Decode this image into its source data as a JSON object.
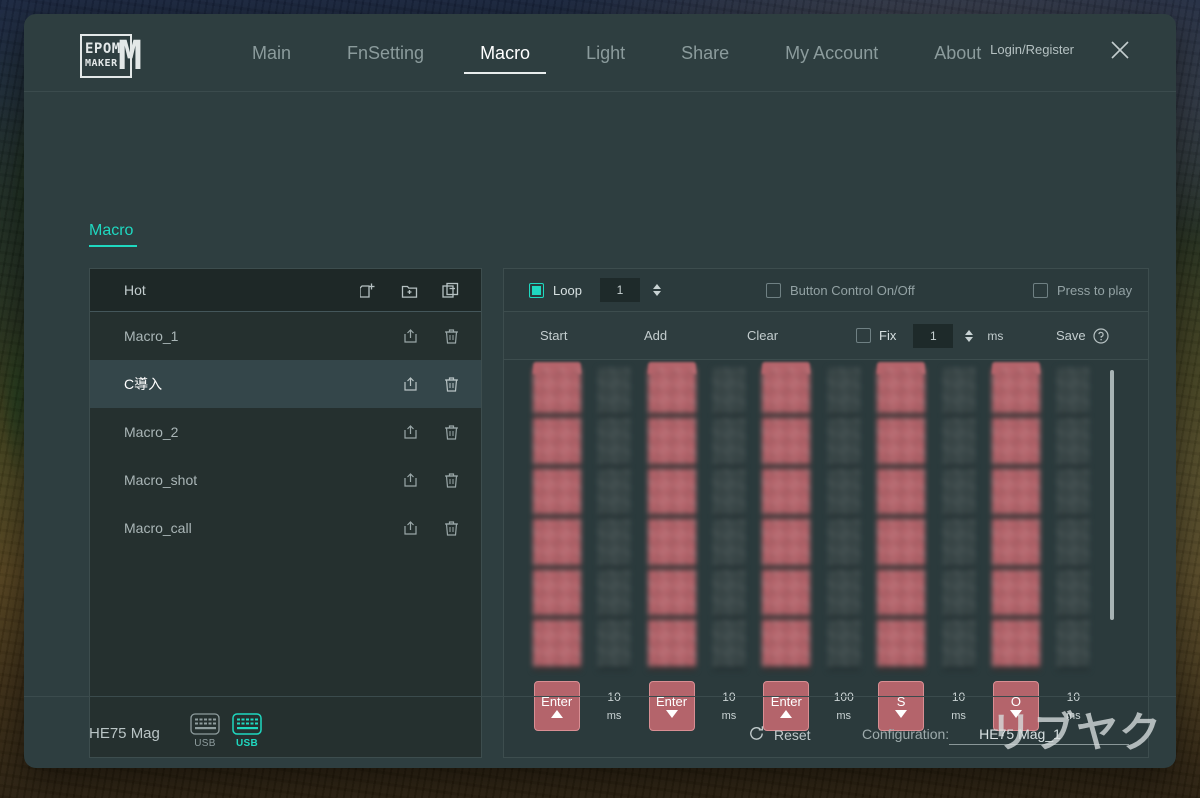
{
  "window": {
    "logo_line1": "EPOM",
    "logo_line2": "MAKER",
    "logo_mark": "M",
    "login_label": "Login/Register",
    "close_icon": "close-icon"
  },
  "nav": {
    "tabs": [
      {
        "label": "Main",
        "active": false
      },
      {
        "label": "FnSetting",
        "active": false
      },
      {
        "label": "Macro",
        "active": true
      },
      {
        "label": "Light",
        "active": false
      },
      {
        "label": "Share",
        "active": false
      },
      {
        "label": "My Account",
        "active": false
      },
      {
        "label": "About",
        "active": false
      }
    ]
  },
  "section": {
    "title": "Macro",
    "accent_color": "#1fd8c0"
  },
  "macro_list": {
    "header_label": "Hot",
    "header_icons": [
      "new-file-icon",
      "new-folder-icon",
      "duplicate-icon"
    ],
    "items": [
      {
        "label": "Macro_1",
        "selected": false
      },
      {
        "label": "C導入",
        "selected": true
      },
      {
        "label": "Macro_2",
        "selected": false
      },
      {
        "label": "Macro_shot",
        "selected": false
      },
      {
        "label": "Macro_call",
        "selected": false
      }
    ],
    "row_icons": [
      "export-icon",
      "delete-icon"
    ]
  },
  "options_bar": {
    "loop_label": "Loop",
    "loop_checked": true,
    "loop_count": "1",
    "button_control_label": "Button Control On/Off",
    "button_control_checked": false,
    "press_to_play_label": "Press to play",
    "press_to_play_checked": false
  },
  "action_bar": {
    "start_label": "Start",
    "add_label": "Add",
    "clear_label": "Clear",
    "fix_label": "Fix",
    "fix_checked": false,
    "fix_value": "1",
    "fix_unit": "ms",
    "save_label": "Save",
    "help_icon": "help-icon"
  },
  "timeline": {
    "events": [
      {
        "type": "key",
        "name": "Enter",
        "direction": "up"
      },
      {
        "type": "delay",
        "value": "10",
        "unit": "ms"
      },
      {
        "type": "key",
        "name": "Enter",
        "direction": "down"
      },
      {
        "type": "delay",
        "value": "10",
        "unit": "ms"
      },
      {
        "type": "key",
        "name": "Enter",
        "direction": "up"
      },
      {
        "type": "delay",
        "value": "100",
        "unit": "ms"
      },
      {
        "type": "key",
        "name": "S",
        "direction": "down"
      },
      {
        "type": "delay",
        "value": "10",
        "unit": "ms"
      },
      {
        "type": "key",
        "name": "O",
        "direction": "down"
      },
      {
        "type": "delay",
        "value": "10",
        "unit": "ms"
      }
    ]
  },
  "footer": {
    "device_name": "HE75 Mag",
    "devices": [
      {
        "label": "USB",
        "active": false
      },
      {
        "label": "USB",
        "active": true
      }
    ],
    "reset_label": "Reset",
    "config_label": "Configuration:",
    "config_value": "HE75 Mag_1"
  },
  "watermark": {
    "text": "リブヤク"
  }
}
